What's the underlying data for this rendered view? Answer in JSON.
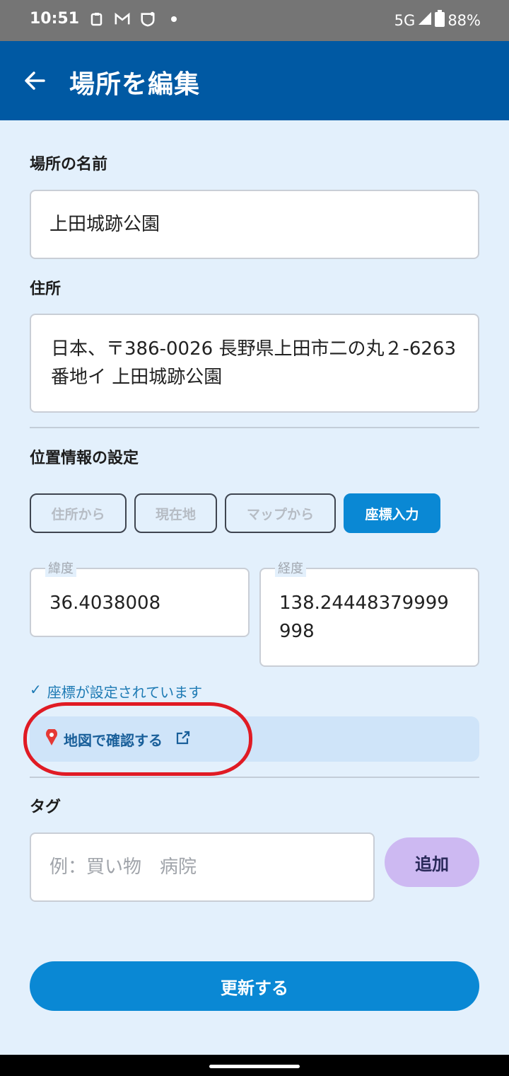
{
  "status_bar": {
    "time": "10:51",
    "network": "5G",
    "battery": "88%",
    "icons": [
      "clipboard-icon",
      "gmail-icon",
      "shield-app-icon",
      "notification-dot-icon",
      "signal-icon",
      "battery-icon"
    ]
  },
  "app_bar": {
    "title": "場所を編集",
    "back_icon": "arrow-back-icon"
  },
  "form": {
    "name_label": "場所の名前",
    "name_value": "上田城跡公園",
    "address_label": "住所",
    "address_value": "日本、〒386-0026 長野県上田市二の丸２-6263番地イ 上田城跡公園",
    "location_label": "位置情報の設定",
    "location_modes": [
      {
        "label": "住所から",
        "active": false
      },
      {
        "label": "現在地",
        "active": false
      },
      {
        "label": "マップから",
        "active": false
      },
      {
        "label": "座標入力",
        "active": true
      }
    ],
    "latitude_label": "緯度",
    "latitude_value": "36.4038008",
    "longitude_label": "経度",
    "longitude_value": "138.24448379999998",
    "coord_status": "座標が設定されています",
    "map_link_label": "地図で確認する",
    "tag_label": "タグ",
    "tag_placeholder": "例：買い物　病院",
    "add_button": "追加",
    "submit_button": "更新する"
  },
  "colors": {
    "app_bar": "#0059a3",
    "background": "#e3f0fc",
    "primary_button": "#0a88d4",
    "add_button": "#cdb9f2",
    "highlight": "#e01b24"
  }
}
